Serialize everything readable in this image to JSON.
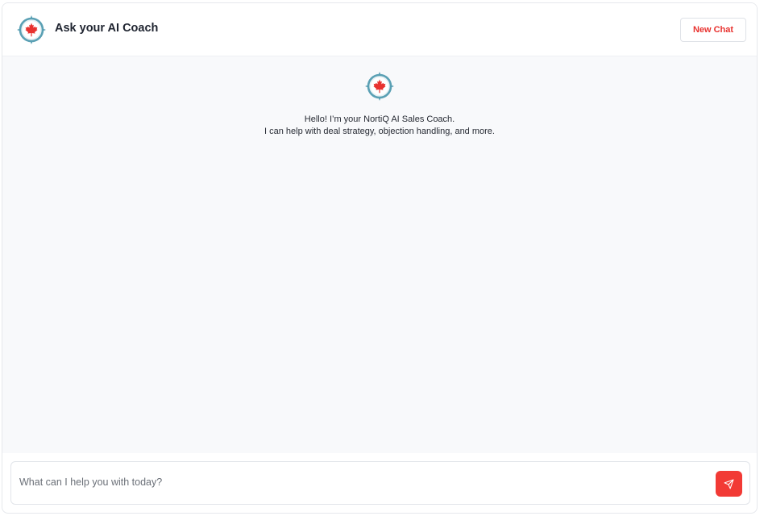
{
  "header": {
    "title": "Ask your AI Coach",
    "logo_icon": "compass-maple-leaf-icon",
    "new_chat_label": "New Chat"
  },
  "welcome": {
    "logo_icon": "compass-maple-leaf-icon",
    "line1": "Hello! I’m your NortiQ AI Sales Coach.",
    "line2": "I can help with deal strategy, objection handling, and more."
  },
  "composer": {
    "placeholder": "What can I help you with today?",
    "value": "",
    "send_icon": "send-icon"
  },
  "colors": {
    "accent": "#f23a35",
    "compass_teal": "#5aa0b4",
    "leaf_red": "#e8322f",
    "chat_bg": "#f8f9fb"
  }
}
